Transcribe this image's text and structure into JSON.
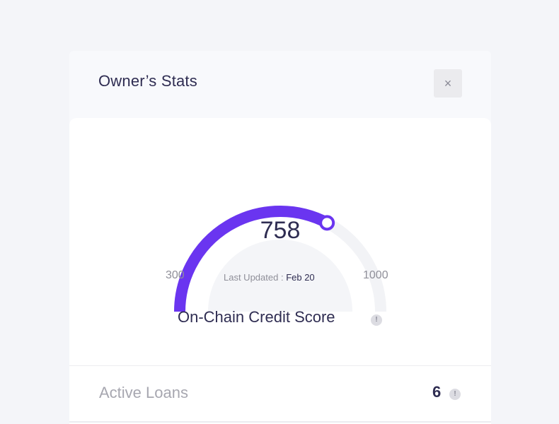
{
  "modal": {
    "title": "Owner’s Stats",
    "close_glyph": "×"
  },
  "credit": {
    "score": "758",
    "score_value": 758,
    "min_label": "300",
    "max_label": "1000",
    "min": 300,
    "max": 1000,
    "updated_label": "Last Updated :",
    "updated_date": "Feb 20",
    "label": "On-Chain Credit Score",
    "info_glyph": "!",
    "colors": {
      "arc": "#6a35f0",
      "track": "#f2f3f6",
      "inner": "#f4f5f8"
    }
  },
  "stats": {
    "active_loans_label": "Active Loans",
    "active_loans_value": "6",
    "info_glyph": "!"
  }
}
